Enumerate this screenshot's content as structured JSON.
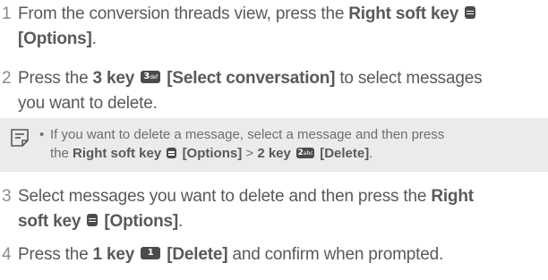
{
  "steps": [
    {
      "number": "1",
      "line1_pre": "From the conversion threads view, press the ",
      "line1_bold": "Right soft key",
      "line2_bold": "[Options]",
      "line2_post": "."
    },
    {
      "number": "2",
      "pre": "Press the ",
      "bold_key": "3 key",
      "key_icon": "3",
      "key_icon_sub": "def",
      "bold_action": "[Select conversation]",
      "post": " to select messages",
      "line2": "you want to delete."
    },
    {
      "number": "3",
      "line1_pre": "Select messages you want to delete and then press the ",
      "line1_bold": "Right",
      "line2_bold": "soft key",
      "line2_bold_action": "[Options]",
      "line2_post": "."
    },
    {
      "number": "4",
      "pre": "Press the ",
      "bold_key": "1 key",
      "key_icon": "1",
      "key_icon_sub": "",
      "bold_action": "[Delete]",
      "post": " and confirm when prompted."
    }
  ],
  "note": {
    "icon": "note-icon",
    "bullet": "•",
    "line1": "If you want to delete a message, select a message and then press",
    "line2_pre": "the ",
    "line2_bold_key": "Right soft key",
    "line2_bold_options": "[Options]",
    "line2_sep": " > ",
    "line2_bold_key2": "2 key",
    "key2_icon": "2",
    "key2_icon_sub": "abc",
    "line2_bold_delete": "[Delete]",
    "line2_post": "."
  },
  "colors": {
    "text": "#58595b",
    "note_bg": "#ebebec",
    "key_bg": "#4a4b4d"
  }
}
